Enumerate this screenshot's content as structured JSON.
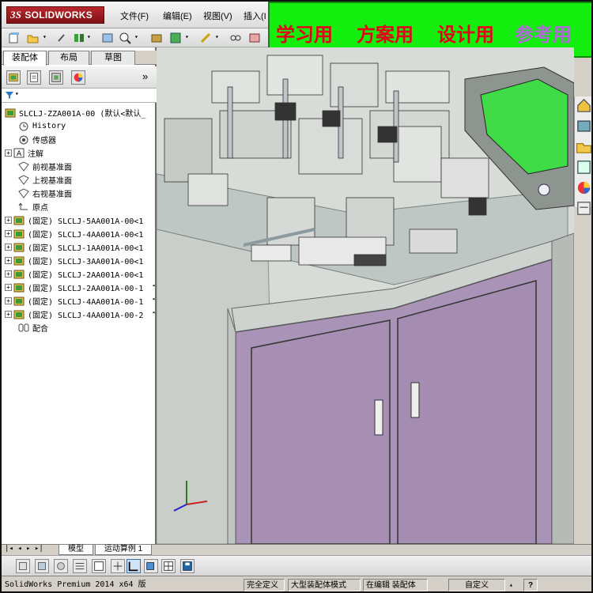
{
  "app": {
    "logo_text": "SOLIDWORKS",
    "logo_mark": "3S"
  },
  "menu": {
    "items": [
      "文件(F)",
      "编辑(E)",
      "视图(V)",
      "插入(I"
    ]
  },
  "banner": {
    "labels": [
      "学习用",
      "方案用",
      "设计用",
      "参考用"
    ]
  },
  "panel": {
    "tabs": [
      "装配体",
      "布局",
      "草图"
    ],
    "collapse_glyph": "»"
  },
  "tree": {
    "root": "SLCLJ-ZZA001A-00 (默认<默认_",
    "items": [
      "History",
      "传感器",
      "注解",
      "前视基准面",
      "上视基准面",
      "右视基准面",
      "原点",
      "(固定) SLCLJ-5AA001A-00<1",
      "(固定) SLCLJ-4AA001A-00<1",
      "(固定) SLCLJ-1AA001A-00<1",
      "(固定) SLCLJ-3AA001A-00<1",
      "(固定) SLCLJ-2AA001A-00<1",
      "(固定) SLCLJ-2AA001A-00-1",
      "(固定) SLCLJ-4AA001A-00-1",
      "(固定) SLCLJ-4AA001A-00-2",
      "配合"
    ]
  },
  "bottom_tabs": [
    "模型",
    "运动算例 1"
  ],
  "status": {
    "version": "SolidWorks Premium 2014 x64 版",
    "cells": [
      "完全定义",
      "大型装配体模式",
      "在编辑 装配体",
      "自定义"
    ],
    "help": "?"
  },
  "colors": {
    "banner_bg": "#14ee0e",
    "banner_text": "#e2031a",
    "banner_last": "#b06ad6",
    "cabinet": "#a993b6",
    "hmi_screen": "#3fdc48"
  }
}
